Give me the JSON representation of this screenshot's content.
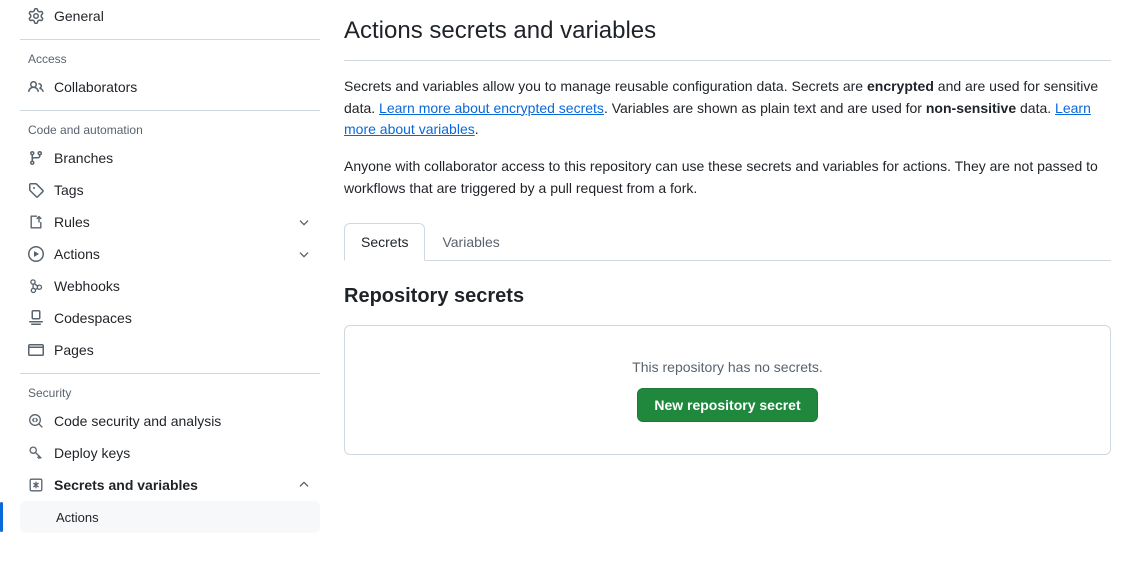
{
  "colors": {
    "accent": "#0969da",
    "success_button": "#1f883d",
    "border": "#d1d9e0",
    "muted_text": "#59636e",
    "selected_bg": "#f6f8fa"
  },
  "sidebar": {
    "groups": [
      {
        "title": null,
        "items": [
          {
            "label": "General",
            "icon": "gear-icon",
            "name": "general",
            "chevron": null,
            "bold": false
          }
        ]
      },
      {
        "title": "Access",
        "items": [
          {
            "label": "Collaborators",
            "icon": "people-icon",
            "name": "collaborators",
            "chevron": null,
            "bold": false
          }
        ]
      },
      {
        "title": "Code and automation",
        "items": [
          {
            "label": "Branches",
            "icon": "git-branch-icon",
            "name": "branches",
            "chevron": null,
            "bold": false
          },
          {
            "label": "Tags",
            "icon": "tag-icon",
            "name": "tags",
            "chevron": null,
            "bold": false
          },
          {
            "label": "Rules",
            "icon": "rules-icon",
            "name": "rules",
            "chevron": "chevron-down-icon",
            "bold": false
          },
          {
            "label": "Actions",
            "icon": "play-icon",
            "name": "actions",
            "chevron": "chevron-down-icon",
            "bold": false
          },
          {
            "label": "Webhooks",
            "icon": "webhook-icon",
            "name": "webhooks",
            "chevron": null,
            "bold": false
          },
          {
            "label": "Codespaces",
            "icon": "codespaces-icon",
            "name": "codespaces",
            "chevron": null,
            "bold": false
          },
          {
            "label": "Pages",
            "icon": "browser-icon",
            "name": "pages",
            "chevron": null,
            "bold": false
          }
        ]
      },
      {
        "title": "Security",
        "items": [
          {
            "label": "Code security and analysis",
            "icon": "codescan-icon",
            "name": "code-security-and-analysis",
            "chevron": null,
            "bold": false
          },
          {
            "label": "Deploy keys",
            "icon": "key-icon",
            "name": "deploy-keys",
            "chevron": null,
            "bold": false
          },
          {
            "label": "Secrets and variables",
            "icon": "asterisk-key-icon",
            "name": "secrets-and-variables",
            "chevron": "chevron-up-icon",
            "bold": true
          }
        ],
        "subitems": [
          {
            "label": "Actions",
            "name": "secrets-actions",
            "selected": true
          }
        ]
      }
    ]
  },
  "main": {
    "title": "Actions secrets and variables",
    "paragraph1": {
      "part1": "Secrets and variables allow you to manage reusable configuration data. Secrets are ",
      "bold1": "encrypted",
      "part2": " and are used for sensitive data. ",
      "link1": "Learn more about encrypted secrets",
      "part3": ". Variables are shown as plain text and are used for ",
      "bold2": "non-sensitive",
      "part4": " data. ",
      "link2": "Learn more about variables",
      "part5": "."
    },
    "paragraph2": "Anyone with collaborator access to this repository can use these secrets and variables for actions. They are not passed to workflows that are triggered by a pull request from a fork.",
    "tabs": [
      {
        "label": "Secrets",
        "name": "tab-secrets",
        "active": true
      },
      {
        "label": "Variables",
        "name": "tab-variables",
        "active": false
      }
    ],
    "section_heading": "Repository secrets",
    "empty_state": {
      "message": "This repository has no secrets.",
      "button_label": "New repository secret"
    }
  }
}
